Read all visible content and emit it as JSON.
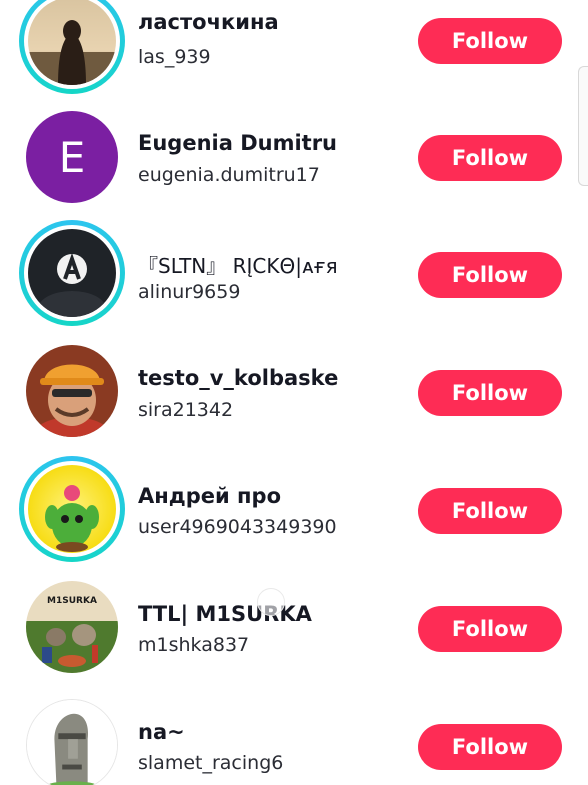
{
  "colors": {
    "follow_bg": "#fe2c55",
    "ring": "#2ec4f0",
    "name": "#161823"
  },
  "follow_label": "Follow",
  "users": [
    {
      "name": "ласточкина",
      "handle": "las_939",
      "ring": true,
      "avatar": "photo-silhouette"
    },
    {
      "name": "Eugenia Dumitru",
      "handle": "eugenia.dumitru17",
      "ring": false,
      "avatar": "letter",
      "letter": "E"
    },
    {
      "name": "『SLTN』 RĮCKΘ|ᴀғя",
      "handle": "alinur9659",
      "ring": true,
      "avatar": "dark-logo"
    },
    {
      "name": "testo_v_kolbaske",
      "handle": "sira21342",
      "ring": false,
      "avatar": "cartoon-engineer"
    },
    {
      "name": "Андрей про",
      "handle": "user4969043349390",
      "ring": true,
      "avatar": "cactus-character"
    },
    {
      "name": "TTL| M1SURKA",
      "handle": "m1shka837",
      "ring": false,
      "avatar": "m1surka-cat",
      "avatar_text": "M1SURKA"
    },
    {
      "name": "na~",
      "handle": "slamet_racing6",
      "ring": false,
      "avatar": "moai-statue"
    }
  ]
}
